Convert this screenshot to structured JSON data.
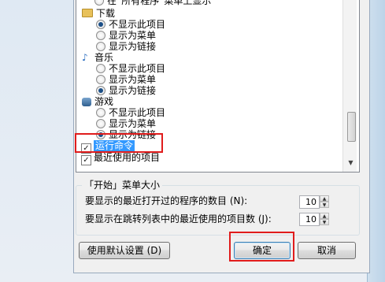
{
  "tree": {
    "top_partial": "在“所有程序”菜单上显示",
    "downloads": {
      "label": "下载",
      "options": [
        "不显示此项目",
        "显示为菜单",
        "显示为链接"
      ],
      "selected": 0
    },
    "music": {
      "label": "音乐",
      "options": [
        "不显示此项目",
        "显示为菜单",
        "显示为链接"
      ],
      "selected": 2
    },
    "games": {
      "label": "游戏",
      "options": [
        "不显示此项目",
        "显示为菜单",
        "显示为链接"
      ],
      "selected": 2
    },
    "run_command": {
      "label": "运行命令",
      "checked": true
    },
    "recent_items": {
      "label": "最近使用的项目",
      "checked": true
    }
  },
  "start_menu_size": {
    "title": "「开始」菜单大小",
    "recent_programs_label": "要显示的最近打开过的程序的数目 (N):",
    "recent_programs_value": "10",
    "jump_list_label": "要显示在跳转列表中的最近使用的项目数 (J):",
    "jump_list_value": "10"
  },
  "buttons": {
    "use_defaults": "使用默认设置 (D)",
    "ok": "确定",
    "cancel": "取消"
  },
  "icons": {
    "folder": "folder-icon",
    "music": "music-note-icon",
    "games": "games-icon"
  },
  "colors": {
    "selection": "#3399ff",
    "annotation": "#e01c1c"
  }
}
